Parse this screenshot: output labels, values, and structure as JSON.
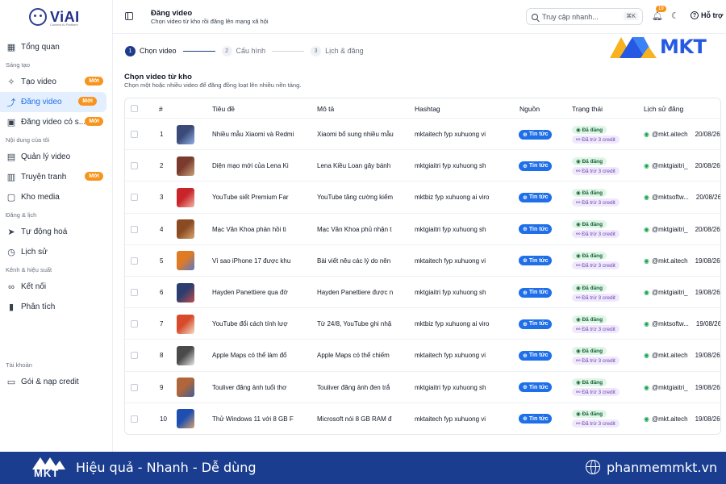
{
  "brand": {
    "name": "ViAI",
    "tagline": "Content AI Platform"
  },
  "header": {
    "title": "Đăng video",
    "subtitle": "Chọn video từ kho rồi đăng lên mạng xã hội",
    "search_placeholder": "Truy cập nhanh...",
    "search_shortcut": "⌘K",
    "notification_count": "19",
    "help_label": "Hỗ trợ"
  },
  "sidebar": {
    "items": [
      {
        "label": "Tổng quan",
        "icon": "grid-icon"
      },
      {
        "section": "Sáng tạo"
      },
      {
        "label": "Tạo video",
        "icon": "sparkle-icon",
        "badge": "Mới"
      },
      {
        "label": "Đăng video",
        "icon": "share-icon",
        "badge": "Mới",
        "active": true
      },
      {
        "label": "Đăng video có s...",
        "icon": "video-icon",
        "badge": "Mới"
      },
      {
        "section": "Nội dung của tôi"
      },
      {
        "label": "Quản lý video",
        "icon": "film-icon"
      },
      {
        "label": "Truyện tranh",
        "icon": "book-icon",
        "badge": "Mới"
      },
      {
        "label": "Kho media",
        "icon": "folder-icon"
      },
      {
        "section": "Đăng & lịch"
      },
      {
        "label": "Tự động hoá",
        "icon": "send-icon"
      },
      {
        "label": "Lịch sử",
        "icon": "clock-icon"
      },
      {
        "section": "Kênh & hiệu suất"
      },
      {
        "label": "Kết nối",
        "icon": "link-icon"
      },
      {
        "label": "Phân tích",
        "icon": "chart-icon"
      },
      {
        "section": "Tài khoản",
        "gap": true
      },
      {
        "label": "Gói & nạp credit",
        "icon": "card-icon"
      }
    ]
  },
  "stepper": [
    {
      "num": "1",
      "label": "Chọn video",
      "active": true
    },
    {
      "num": "2",
      "label": "Cấu hình"
    },
    {
      "num": "3",
      "label": "Lịch & đăng"
    }
  ],
  "watermark": {
    "text": "MKT"
  },
  "section": {
    "title": "Chọn video từ kho",
    "subtitle": "Chọn một hoặc nhiều video để đăng đồng loạt lên nhiều nền tảng."
  },
  "table": {
    "columns": [
      "#",
      "Tiêu đề",
      "Mô tả",
      "Hashtag",
      "Nguồn",
      "Trạng thái",
      "Lịch sử đăng"
    ],
    "status_label": "Đã đăng",
    "credit_label": "Đã trừ 3 credit",
    "rows": [
      {
        "n": "1",
        "title": "Nhiều mẫu Xiaomi và Redmi",
        "desc": "Xiaomi bổ sung nhiều mẫu",
        "tags": "mktaitech fyp xuhuong vi",
        "source": "Tin tức",
        "account": "@mkt.aitech",
        "date": "20/08/26",
        "thumb": [
          "#3b4a78",
          "#8fb0e8"
        ]
      },
      {
        "n": "2",
        "title": "Diện mạo mới của Lena Ki",
        "desc": "Lena Kiều Loan gây bánh",
        "tags": "mktgiaitri fyp xuhuong sh",
        "source": "Tin tức",
        "account": "@mktgiaitri_",
        "date": "20/08/26",
        "thumb": [
          "#7a3b2e",
          "#c9a37a"
        ]
      },
      {
        "n": "3",
        "title": "YouTube siết Premium Far",
        "desc": "YouTube tăng cường kiểm",
        "tags": "mktbiz fyp xuhuong ai viro",
        "source": "Tin tức",
        "account": "@mktsoftw...",
        "date": "20/08/26",
        "thumb": [
          "#c8242a",
          "#f1b7a8"
        ]
      },
      {
        "n": "4",
        "title": "Mạc Văn Khoa phản hồi ti",
        "desc": "Mạc Văn Khoa phủ nhận t",
        "tags": "mktgiaitri fyp xuhuong sh",
        "source": "Tin tức",
        "account": "@mktgiaitri_",
        "date": "20/08/26",
        "thumb": [
          "#8a4a22",
          "#d7a56d"
        ]
      },
      {
        "n": "5",
        "title": "Vì sao iPhone 17 được khu",
        "desc": "Bài viết nêu các lý do nên",
        "tags": "mktaitech fyp xuhuong vi",
        "source": "Tin tức",
        "account": "@mkt.aitech",
        "date": "19/08/26",
        "thumb": [
          "#e07b24",
          "#5a78c8"
        ]
      },
      {
        "n": "6",
        "title": "Hayden Panettiere qua đờ",
        "desc": "Hayden Panettiere được n",
        "tags": "mktgiaitri fyp xuhuong sh",
        "source": "Tin tức",
        "account": "@mktgiaitri_",
        "date": "19/08/26",
        "thumb": [
          "#2c3e70",
          "#c44b4b"
        ]
      },
      {
        "n": "7",
        "title": "YouTube đổi cách tính lượ",
        "desc": "Từ 24/8, YouTube ghi nhậ",
        "tags": "mktbiz fyp xuhuong ai viro",
        "source": "Tin tức",
        "account": "@mktsoftw...",
        "date": "19/08/26",
        "thumb": [
          "#d84a2b",
          "#f0e0c8"
        ]
      },
      {
        "n": "8",
        "title": "Apple Maps có thể làm đổ",
        "desc": "Apple Maps có thể chiếm",
        "tags": "mktaitech fyp xuhuong vi",
        "source": "Tin tức",
        "account": "@mkt.aitech",
        "date": "19/08/26",
        "thumb": [
          "#4a4a4a",
          "#e8e8e8"
        ]
      },
      {
        "n": "9",
        "title": "Touliver đăng ảnh tuổi thơ",
        "desc": "Touliver đăng ảnh đen trắ",
        "tags": "mktgiaitri fyp xuhuong sh",
        "source": "Tin tức",
        "account": "@mktgiaitri_",
        "date": "19/08/26",
        "thumb": [
          "#b0663a",
          "#3d5f9a"
        ]
      },
      {
        "n": "10",
        "title": "Thử Windows 11 với 8 GB F",
        "desc": "Microsoft nói 8 GB RAM đ",
        "tags": "mktaitech fyp xuhuong vi",
        "source": "Tin tức",
        "account": "@mkt.aitech",
        "date": "19/08/26",
        "thumb": [
          "#1e4fb0",
          "#d8a070"
        ]
      }
    ]
  },
  "footer": {
    "logo": "MKT",
    "slogan": "Hiệu quả - Nhanh - Dễ dùng",
    "url": "phanmemmkt.vn"
  },
  "colors": {
    "accent": "#1e6fe8",
    "badge": "#f7941d",
    "footer": "#1a3d8f",
    "success": "#166534",
    "credit": "#6b3fb5"
  }
}
